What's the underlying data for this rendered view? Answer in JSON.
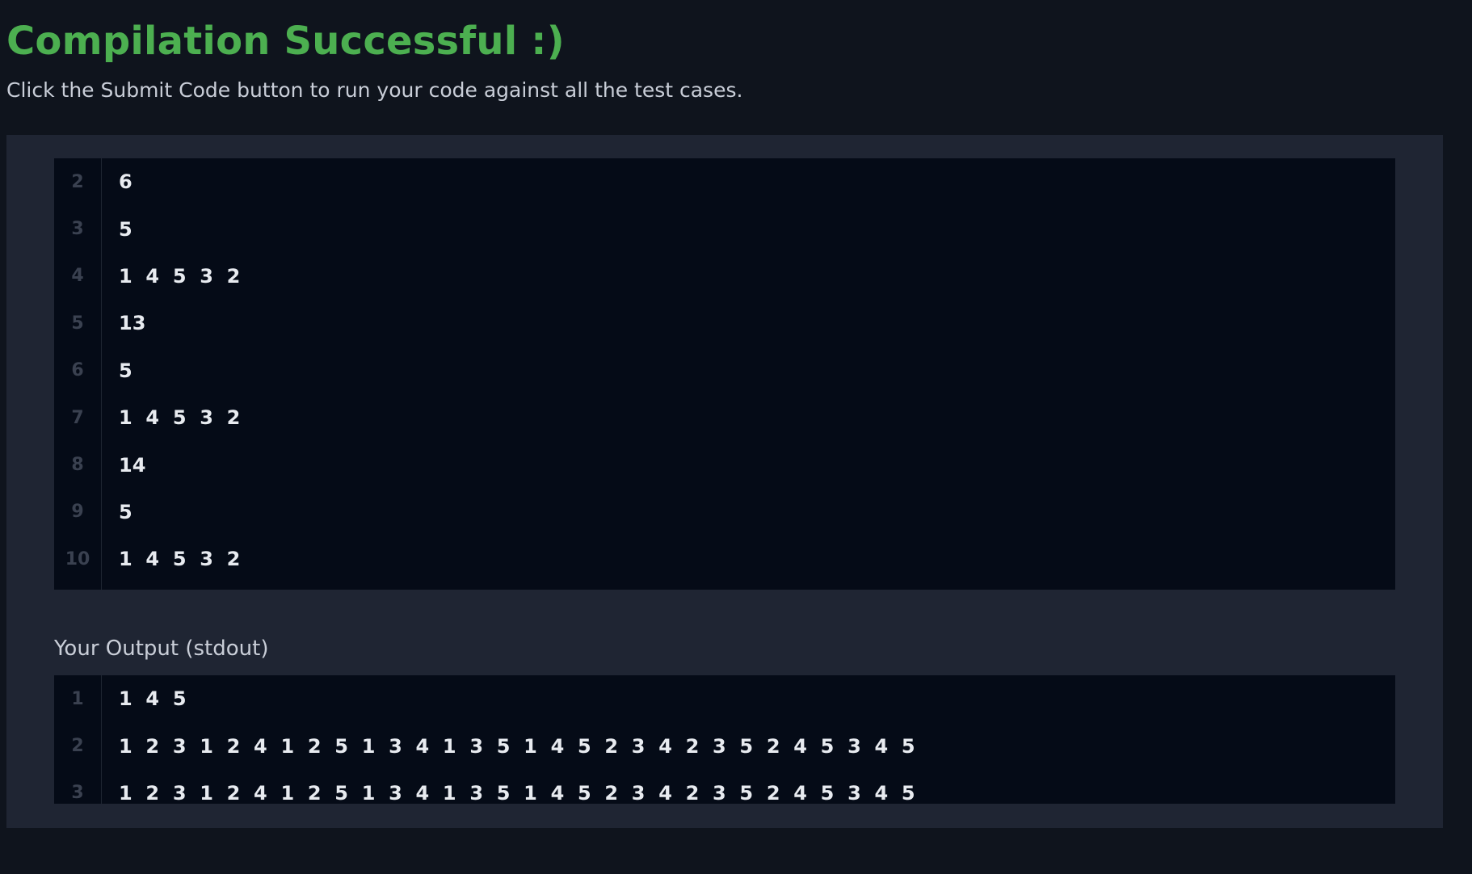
{
  "header": {
    "title": "Compilation Successful :)",
    "subtitle": "Click the Submit Code button to run your code against all the test cases."
  },
  "input": {
    "lines": [
      {
        "number": "2",
        "text": "6"
      },
      {
        "number": "3",
        "text": "5"
      },
      {
        "number": "4",
        "text": "1  4  5  3  2"
      },
      {
        "number": "5",
        "text": "13"
      },
      {
        "number": "6",
        "text": "5"
      },
      {
        "number": "7",
        "text": "1  4  5  3  2"
      },
      {
        "number": "8",
        "text": "14"
      },
      {
        "number": "9",
        "text": "5"
      },
      {
        "number": "10",
        "text": "1  4  5  3  2"
      }
    ]
  },
  "output": {
    "label": "Your Output (stdout)",
    "lines": [
      {
        "number": "1",
        "text": "1  4  5"
      },
      {
        "number": "2",
        "text": "1  2  3  1  2  4  1  2  5  1  3  4  1  3  5  1  4  5  2  3  4  2  3  5  2  4  5  3  4  5"
      },
      {
        "number": "3",
        "text": "1  2  3  1  2  4  1  2  5  1  3  4  1  3  5  1  4  5  2  3  4  2  3  5  2  4  5  3  4  5"
      }
    ]
  }
}
